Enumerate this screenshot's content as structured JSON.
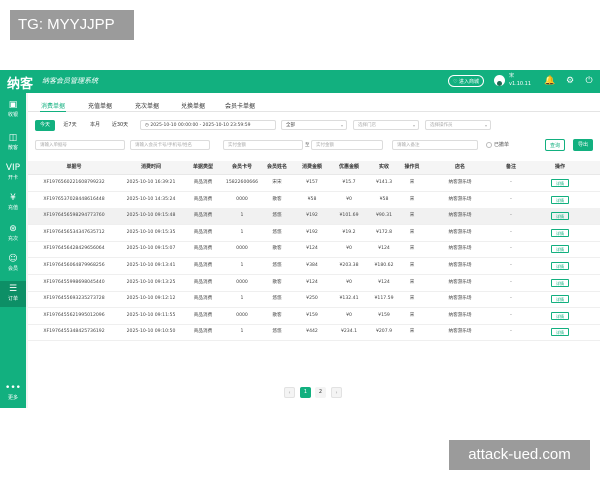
{
  "watermarks": {
    "top_left": "TG: MYYJJPP",
    "bottom_right": "attack-ued.com"
  },
  "header": {
    "logo": "纳客",
    "slogan": "纳客会员管理系统",
    "enter_store": "进入商城",
    "user_name": "宋",
    "version": "v1.10.11"
  },
  "sidebar": {
    "items": [
      {
        "label": "收银",
        "icon": "cash-register-icon"
      },
      {
        "label": "散客",
        "icon": "guest-icon"
      },
      {
        "label": "开卡",
        "icon": "vip-card-icon"
      },
      {
        "label": "充值",
        "icon": "recharge-icon"
      },
      {
        "label": "充次",
        "icon": "count-recharge-icon"
      },
      {
        "label": "会员",
        "icon": "member-icon"
      },
      {
        "label": "订单",
        "icon": "order-icon"
      },
      {
        "label": "更多",
        "icon": "more-icon"
      }
    ]
  },
  "tabs": [
    "消费单据",
    "充值单据",
    "充次单据",
    "兑换单据",
    "会员卡单据"
  ],
  "filters": {
    "quick": [
      "今天",
      "近7天",
      "本月",
      "近30天"
    ],
    "date_start": "2025-10-10 00:00:00",
    "date_sep": "-",
    "date_end": "2025-10-10 23:59:59",
    "all_option": "全部",
    "store_placeholder": "选择门店",
    "operator_placeholder": "选择操作员",
    "order_placeholder": "请输入单据号",
    "member_placeholder": "请输入会员卡号/手机号/姓名",
    "amount_min": "实付金额",
    "amount_to": "至",
    "amount_max": "实付金额",
    "note_placeholder": "请输入备注",
    "abolished": "已撤单",
    "query_button": "查询",
    "export_button": "导出"
  },
  "table": {
    "headers": [
      "单据号",
      "消费时间",
      "单据类型",
      "会员卡号",
      "会员姓名",
      "消费金额",
      "优惠金额",
      "实收",
      "操作员",
      "店名",
      "备注",
      "操作"
    ],
    "rows": [
      [
        "XF1976560221608799232",
        "2025-10-10 16:39:21",
        "商品消费",
        "15822600666",
        "宋宋",
        "¥157",
        "¥15.7",
        "¥141.3",
        "宋",
        "纳客游乐场",
        "-",
        "详情"
      ],
      [
        "XF1976537028448616448",
        "2025-10-10 14:35:24",
        "商品消费",
        "0000",
        "散客",
        "¥58",
        "¥0",
        "¥58",
        "宋",
        "纳客游乐场",
        "-",
        "详情"
      ],
      [
        "XF1976456598294773760",
        "2025-10-10 09:15:48",
        "商品消费",
        "1",
        "悠悠",
        "¥192",
        "¥101.69",
        "¥90.31",
        "宋",
        "纳客游乐场",
        "-",
        "详情"
      ],
      [
        "XF1976456534347635712",
        "2025-10-10 09:15:35",
        "商品消费",
        "1",
        "悠悠",
        "¥192",
        "¥19.2",
        "¥172.8",
        "宋",
        "纳客游乐场",
        "-",
        "详情"
      ],
      [
        "XF1976456428429656064",
        "2025-10-10 09:15:07",
        "商品消费",
        "0000",
        "散客",
        "¥124",
        "¥0",
        "¥124",
        "宋",
        "纳客游乐场",
        "-",
        "详情"
      ],
      [
        "XF1976456064879968256",
        "2025-10-10 09:13:41",
        "商品消费",
        "1",
        "悠悠",
        "¥384",
        "¥203.38",
        "¥180.62",
        "宋",
        "纳客游乐场",
        "-",
        "详情"
      ],
      [
        "XF1976455998698045440",
        "2025-10-10 09:13:25",
        "商品消费",
        "0000",
        "散客",
        "¥124",
        "¥0",
        "¥124",
        "宋",
        "纳客游乐场",
        "-",
        "详情"
      ],
      [
        "XF1976455693235273728",
        "2025-10-10 09:12:12",
        "商品消费",
        "1",
        "悠悠",
        "¥250",
        "¥132.41",
        "¥117.59",
        "宋",
        "纳客游乐场",
        "-",
        "详情"
      ],
      [
        "XF1976455621995012096",
        "2025-10-10 09:11:55",
        "商品消费",
        "0000",
        "散客",
        "¥159",
        "¥0",
        "¥159",
        "宋",
        "纳客游乐场",
        "-",
        "详情"
      ],
      [
        "XF1976455348425736192",
        "2025-10-10 09:10:50",
        "商品消费",
        "1",
        "悠悠",
        "¥442",
        "¥234.1",
        "¥207.9",
        "宋",
        "纳客游乐场",
        "-",
        "详情"
      ]
    ]
  },
  "pagination": {
    "prev": "‹",
    "pages": [
      "1",
      "2"
    ],
    "next": "›",
    "current": "1"
  },
  "colors": {
    "brand": "#12b07f",
    "brand_dark": "#0d8f66"
  }
}
